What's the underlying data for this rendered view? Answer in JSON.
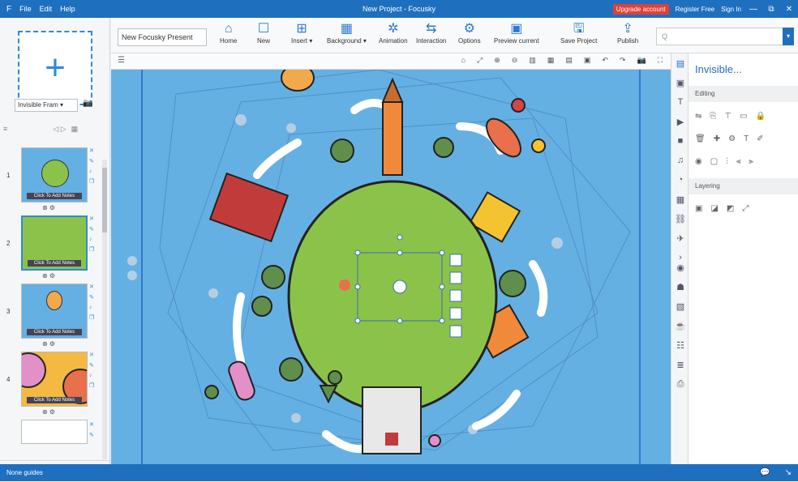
{
  "titlebar": {
    "menu_icon": "F",
    "menu": [
      "File",
      "Edit",
      "Help"
    ],
    "title": "New Project - Focusky",
    "upgrade": "Upgrade account",
    "register": "Register Free",
    "signin": "Sign In",
    "controls": [
      "—",
      "⧉",
      "✕"
    ]
  },
  "left": {
    "add_icon": "+",
    "frame_type": "Invisible Fram ▾",
    "thumbs": [
      {
        "num": "1",
        "label": "Click To Add Notes"
      },
      {
        "num": "2",
        "label": "Click To Add Notes"
      },
      {
        "num": "3",
        "label": "Click To Add Notes"
      },
      {
        "num": "4",
        "label": "Click To Add Notes"
      }
    ]
  },
  "toolbar": {
    "project_name": "New Focusky Present",
    "buttons": [
      {
        "label": "Home",
        "glyph": "⌂"
      },
      {
        "label": "New",
        "glyph": "☐"
      },
      {
        "label": "Insert ▾",
        "glyph": "⊞"
      },
      {
        "label": "Background ▾",
        "glyph": "▦"
      },
      {
        "label": "Animation",
        "glyph": "✲"
      },
      {
        "label": "Interaction",
        "glyph": "⇆"
      },
      {
        "label": "Options",
        "glyph": "⚙"
      },
      {
        "label": "Preview current",
        "glyph": "▣"
      },
      {
        "label": "Save Project",
        "glyph": "🖫"
      },
      {
        "label": "Publish",
        "glyph": "⇪"
      }
    ],
    "search_placeholder": "Q"
  },
  "rightpanel": {
    "title": "Invisible...",
    "editing": "Editing",
    "layering": "Layering"
  },
  "status": {
    "text": "None guides",
    "icons": [
      "💬",
      "↘"
    ]
  },
  "colors": {
    "brand": "#1f6fbf",
    "canvas": "#65b0e3",
    "planet": "#8bc34a"
  }
}
